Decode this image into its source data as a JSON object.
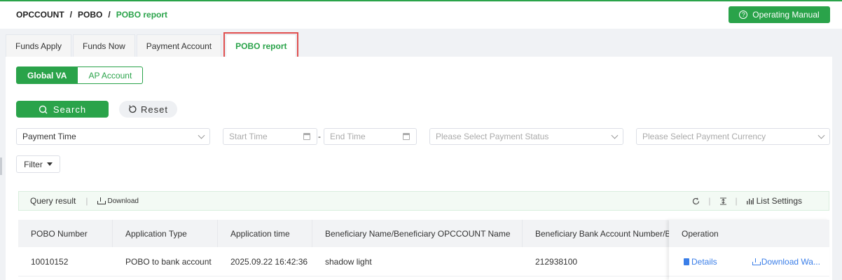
{
  "breadcrumb": {
    "items": [
      "OPCCOUNT",
      "POBO",
      "POBO report"
    ]
  },
  "header": {
    "manual_label": "Operating Manual"
  },
  "tabs": [
    {
      "label": "Funds Apply"
    },
    {
      "label": "Funds Now"
    },
    {
      "label": "Payment Account"
    },
    {
      "label": "POBO report",
      "active": true
    }
  ],
  "segment": {
    "global_va": "Global VA",
    "ap_account": "AP Account"
  },
  "actions": {
    "search": "Search",
    "reset": "Reset",
    "filter": "Filter"
  },
  "filters": {
    "time_type": "Payment Time",
    "start_time_placeholder": "Start Time",
    "end_time_placeholder": "End Time",
    "status_placeholder": "Please Select Payment Status",
    "currency_placeholder": "Please Select Payment Currency"
  },
  "toolbar": {
    "query_result": "Query result",
    "download": "Download",
    "list_settings": "List Settings"
  },
  "table": {
    "columns": [
      "POBO Number",
      "Application Type",
      "Application time",
      "Beneficiary Name/Beneficiary OPCCOUNT Name",
      "Beneficiary Bank Account Number/Ben",
      "Operation"
    ],
    "rows": [
      {
        "pobo_number": "10010152",
        "application_type": "POBO to bank account",
        "application_time": "2025.09.22 16:42:36",
        "beneficiary_name": "shadow light",
        "bank_account": "212938100",
        "details": "Details",
        "download": "Download Wa..."
      }
    ]
  },
  "colors": {
    "accent": "#2aa34a",
    "link": "#3a7ee8",
    "highlight": "#e04f4f"
  }
}
